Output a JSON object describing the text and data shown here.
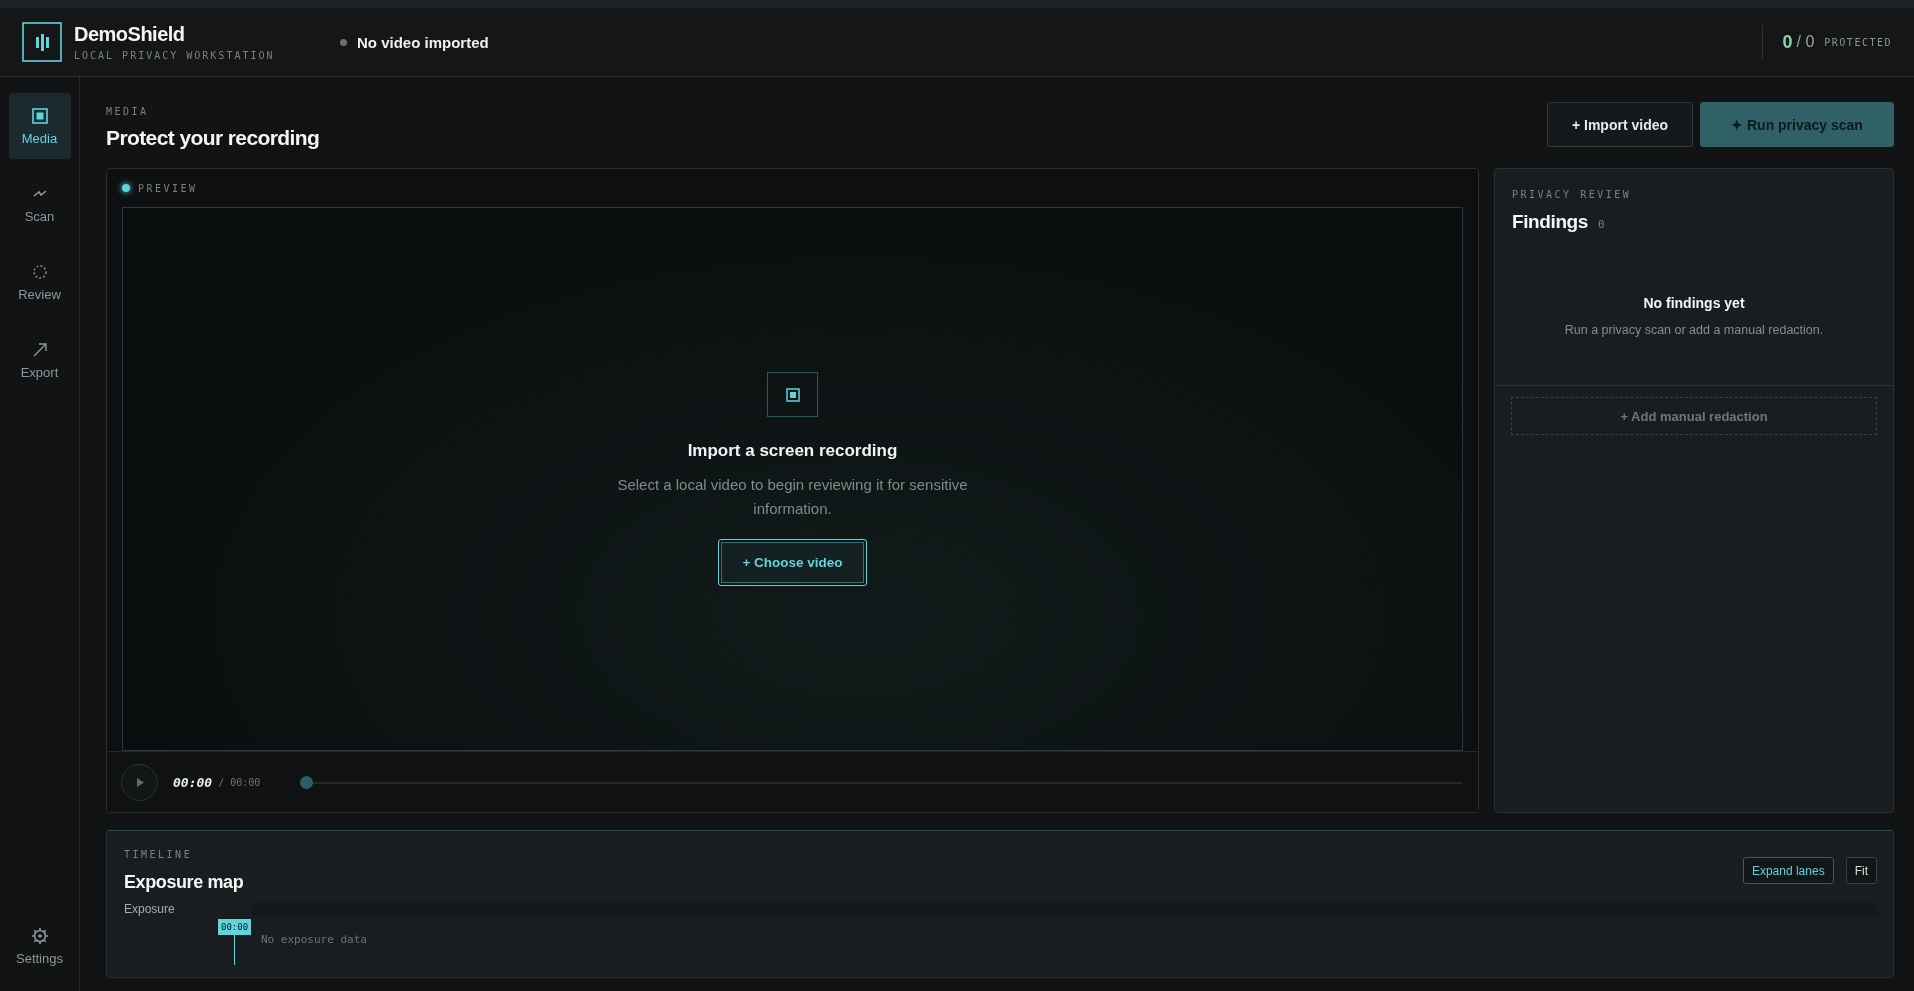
{
  "app": {
    "name": "DemoShield",
    "subtitle": "LOCAL PRIVACY WORKSTATION"
  },
  "status": {
    "text": "No video imported",
    "active": false
  },
  "protected": {
    "count": "0",
    "total": "/ 0",
    "label": "PROTECTED"
  },
  "sidebar": {
    "items": [
      {
        "label": "Media",
        "selected": true
      },
      {
        "label": "Scan",
        "selected": false
      },
      {
        "label": "Review",
        "selected": false
      },
      {
        "label": "Export",
        "selected": false
      }
    ],
    "footer": {
      "label": "Settings",
      "selected": false
    }
  },
  "page": {
    "eyebrow": "MEDIA",
    "title": "Protect your recording",
    "actions": [
      {
        "label": "+ Import video",
        "kind": "secondary"
      },
      {
        "label": "✦ Run privacy scan",
        "kind": "primary"
      }
    ]
  },
  "preview": {
    "label": "PREVIEW",
    "live": true,
    "empty": {
      "title": "Import a screen recording",
      "text": "Select a local video to begin reviewing it for sensitive information.",
      "button": "+ Choose video"
    },
    "player": {
      "current": "00:00",
      "separator": "/",
      "duration": "00:00",
      "level": 0
    }
  },
  "findings": {
    "eyebrow": "PRIVACY REVIEW",
    "title": "Findings",
    "count": "0",
    "empty_title": "No findings yet",
    "empty_text": "Run a privacy scan or add a manual redaction.",
    "add_button": "+ Add manual redaction"
  },
  "timeline": {
    "eyebrow": "TIMELINE",
    "title": "Exposure map",
    "buttons": [
      {
        "label": "Expand lanes",
        "kind": "accent"
      },
      {
        "label": "Fit",
        "kind": "plain"
      }
    ],
    "lanes": [
      {
        "label": "Exposure"
      }
    ],
    "empty": "No exposure data",
    "playhead": {
      "time": "00:00"
    }
  }
}
